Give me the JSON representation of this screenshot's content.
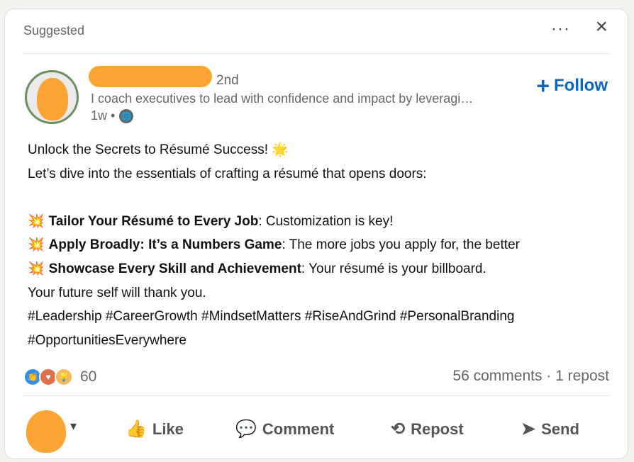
{
  "header": {
    "suggested": "Suggested",
    "more": "···",
    "close": "×"
  },
  "author": {
    "degree": "2nd",
    "headline": "I coach executives to lead with confidence and impact by leveragi…",
    "time": "1w •",
    "visibility_icon": "globe-icon"
  },
  "follow": {
    "plus": "+",
    "label": "Follow"
  },
  "post": {
    "lines": [
      {
        "text": "Unlock the Secrets to Résumé Success! 🌟"
      },
      {
        "text": "Let’s dive into the essentials of crafting a résumé that opens doors:"
      },
      {
        "text": ""
      },
      {
        "emoji": "💥",
        "bold": "Tailor Your Résumé to Every Job",
        "rest": ": Customization is key!"
      },
      {
        "emoji": "💥",
        "bold": "Apply Broadly: It’s a Numbers Game",
        "rest": ": The more jobs you apply for, the better"
      },
      {
        "emoji": "💥",
        "bold": "Showcase Every Skill and Achievement",
        "rest": ": Your résumé is your billboard."
      },
      {
        "text": "Your future self will thank you."
      },
      {
        "text": "#Leadership #CareerGrowth #MindsetMatters #RiseAndGrind #PersonalBranding"
      },
      {
        "text": "#OpportunitiesEverywhere"
      }
    ]
  },
  "reactions": {
    "icons": [
      "clap-icon",
      "heart-icon",
      "bulb-icon"
    ],
    "count": "60"
  },
  "stats": "56 comments · 1 repost",
  "actions": {
    "caret": "▾",
    "like": {
      "icon": "thumbs-up-icon",
      "label": "Like"
    },
    "comment": {
      "icon": "comment-icon",
      "label": "Comment"
    },
    "repost": {
      "icon": "repost-icon",
      "label": "Repost"
    },
    "send": {
      "icon": "send-icon",
      "label": "Send"
    }
  },
  "colors": {
    "accent": "#0a66c2",
    "redaction": "#fda534"
  }
}
